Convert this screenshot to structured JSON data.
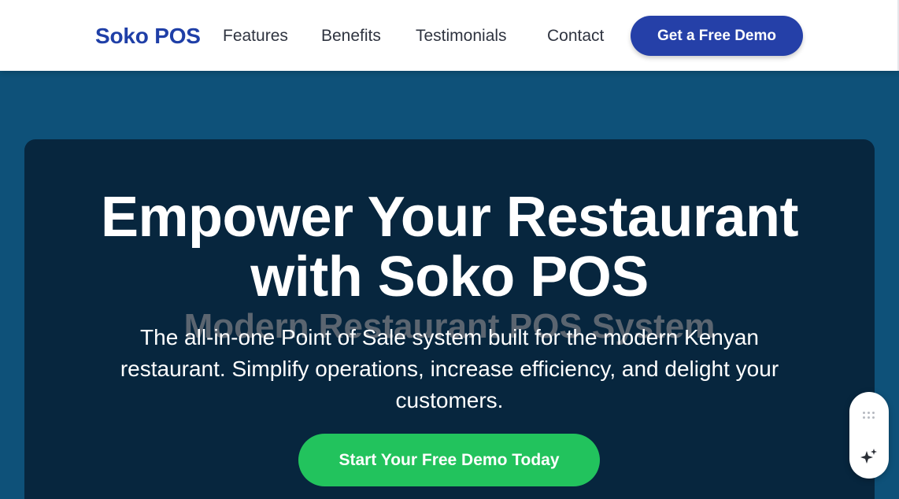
{
  "header": {
    "brand": "Soko POS",
    "nav": {
      "features": "Features",
      "benefits": "Benefits",
      "testimonials": "Testimonials",
      "contact": "Contact"
    },
    "demo_button": "Get a Free Demo"
  },
  "hero": {
    "title_line1": "Empower Your Restaurant",
    "title_line2": "with Soko POS",
    "ghost_subtitle": "Modern Restaurant POS System",
    "description": "The all-in-one Point of Sale system built for the modern Kenyan restaurant. Simplify operations, increase efficiency, and delight your customers.",
    "cta_button": "Start Your Free Demo Today"
  },
  "widget": {
    "icons": [
      "drag-handle-icon",
      "sparkle-icon"
    ]
  },
  "colors": {
    "brand": "#1f3fa7",
    "primary_button": "#2540a8",
    "hero_band": "#0e5179",
    "hero_card": "#07263e",
    "cta_green": "#22c35d"
  }
}
